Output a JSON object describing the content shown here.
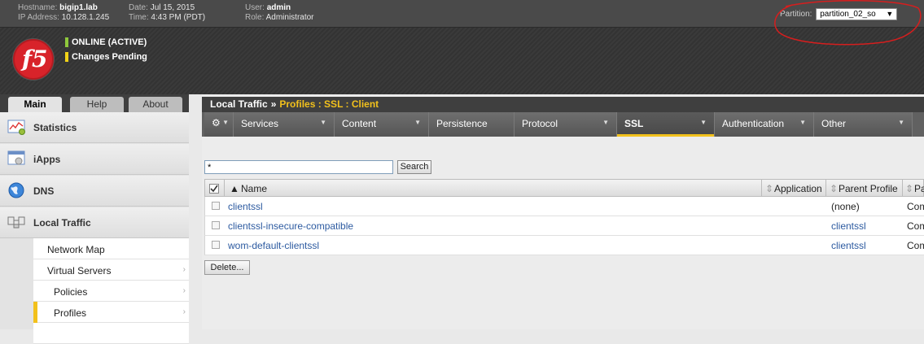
{
  "topbar": {
    "hostname_label": "Hostname:",
    "hostname": "bigip1.lab",
    "ip_label": "IP Address:",
    "ip": "10.128.1.245",
    "date_label": "Date:",
    "date": "Jul 15, 2015",
    "time_label": "Time:",
    "time": "4:43 PM (PDT)",
    "user_label": "User:",
    "user": "admin",
    "role_label": "Role:",
    "role": "Administrator",
    "partition_label": "Partition:",
    "partition_value": "partition_02_so"
  },
  "banner": {
    "logo_text": "f5",
    "status_online": "ONLINE (ACTIVE)",
    "status_changes": "Changes Pending"
  },
  "leftnav": {
    "tabs": [
      "Main",
      "Help",
      "About"
    ],
    "sections": [
      {
        "label": "Statistics",
        "icon": "statistics-icon"
      },
      {
        "label": "iApps",
        "icon": "iapps-icon"
      },
      {
        "label": "DNS",
        "icon": "dns-globe-icon"
      },
      {
        "label": "Local Traffic",
        "icon": "local-traffic-icon"
      }
    ],
    "sub_items": [
      "Network Map",
      "Virtual Servers",
      "Policies",
      "Profiles"
    ]
  },
  "breadcrumb": {
    "root": "Local Traffic",
    "separator": "»",
    "current": "Profiles : SSL : Client"
  },
  "menubar": {
    "gear_icon": "gear-icon",
    "items": [
      "Services",
      "Content",
      "Persistence",
      "Protocol",
      "SSL",
      "Authentication",
      "Other"
    ],
    "selected": "SSL"
  },
  "search": {
    "value": "*",
    "button_label": "Search"
  },
  "table": {
    "headers": [
      "Name",
      "Application",
      "Parent Profile",
      "Pa"
    ],
    "rows": [
      {
        "name": "clientssl",
        "application": "",
        "parent": "(none)",
        "partition": "Com"
      },
      {
        "name": "clientssl-insecure-compatible",
        "application": "",
        "parent": "clientssl",
        "partition": "Com"
      },
      {
        "name": "wom-default-clientssl",
        "application": "",
        "parent": "clientssl",
        "partition": "Com"
      }
    ]
  },
  "actions": {
    "delete_label": "Delete..."
  },
  "colors": {
    "accent": "#f2c11c",
    "link": "#2c5aa0",
    "online": "#8fc83c",
    "brand_red": "#d8232a"
  }
}
